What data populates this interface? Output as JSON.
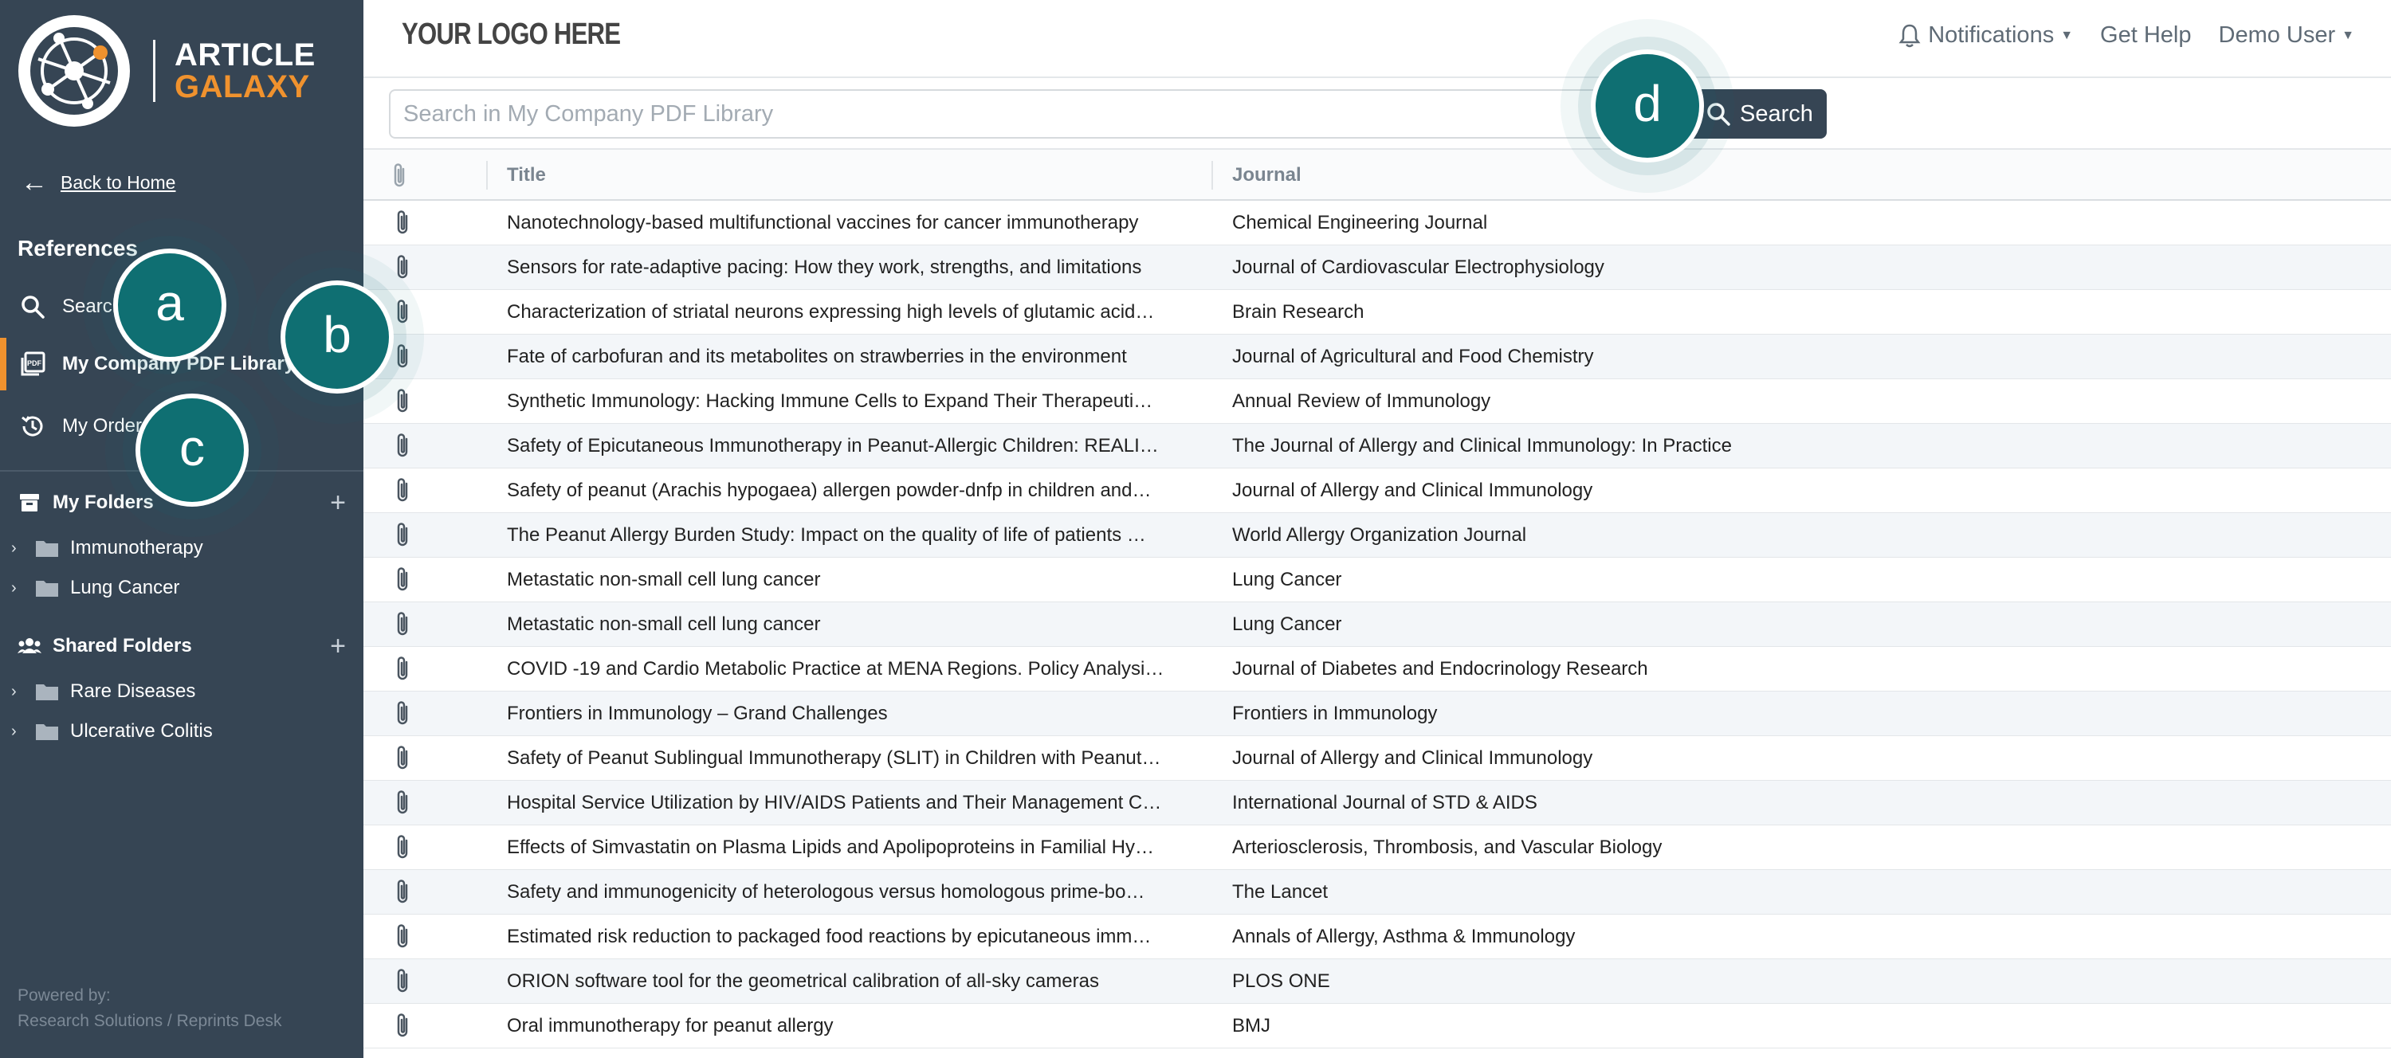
{
  "brand": {
    "line1": "ARTICLE",
    "line2": "GALAXY",
    "accent_color": "#f0922e",
    "sidebar_color": "#364554"
  },
  "sidebar": {
    "back_label": "Back to Home",
    "references_heading": "References",
    "nav": [
      {
        "label": "Search",
        "icon": "search-icon"
      },
      {
        "label": "My Company PDF Library",
        "icon": "pdf-library-icon",
        "active": true
      },
      {
        "label": "My Orders",
        "icon": "history-icon"
      }
    ],
    "my_folders": {
      "heading": "My Folders",
      "items": [
        "Immunotherapy",
        "Lung Cancer"
      ]
    },
    "shared_folders": {
      "heading": "Shared Folders",
      "items": [
        "Rare Diseases",
        "Ulcerative Colitis"
      ]
    },
    "powered_by": "Powered by:",
    "powered_company": "Research Solutions / Reprints Desk"
  },
  "header": {
    "logo_placeholder": "YOUR LOGO HERE",
    "notifications": "Notifications",
    "help": "Get Help",
    "user": "Demo User"
  },
  "search": {
    "placeholder": "Search in My Company PDF Library",
    "button": "Search"
  },
  "table": {
    "columns": {
      "title": "Title",
      "journal": "Journal"
    },
    "rows": [
      {
        "title": "Nanotechnology-based multifunctional vaccines for cancer immunotherapy",
        "journal": "Chemical Engineering Journal"
      },
      {
        "title": "Sensors for rate-adaptive pacing: How they work, strengths, and limitations",
        "journal": "Journal of Cardiovascular Electrophysiology"
      },
      {
        "title": "Characterization of striatal neurons expressing high levels of glutamic acid…",
        "journal": "Brain Research"
      },
      {
        "title": "Fate of carbofuran and its metabolites on strawberries in the environment",
        "journal": "Journal of Agricultural and Food Chemistry"
      },
      {
        "title": "Synthetic Immunology: Hacking Immune Cells to Expand Their Therapeuti…",
        "journal": "Annual Review of Immunology"
      },
      {
        "title": "Safety of Epicutaneous Immunotherapy in Peanut-Allergic Children: REALI…",
        "journal": "The Journal of Allergy and Clinical Immunology: In Practice"
      },
      {
        "title": "Safety of peanut (Arachis hypogaea) allergen powder-dnfp in children and…",
        "journal": "Journal of Allergy and Clinical Immunology"
      },
      {
        "title": "The Peanut Allergy Burden Study: Impact on the quality of life of patients …",
        "journal": "World Allergy Organization Journal"
      },
      {
        "title": "Metastatic non-small cell lung cancer",
        "journal": "Lung Cancer"
      },
      {
        "title": "Metastatic non-small cell lung cancer",
        "journal": "Lung Cancer"
      },
      {
        "title": "COVID -19 and Cardio Metabolic Practice at MENA Regions. Policy Analysi…",
        "journal": "Journal of Diabetes and Endocrinology Research"
      },
      {
        "title": "Frontiers in Immunology – Grand Challenges",
        "journal": "Frontiers in Immunology"
      },
      {
        "title": "Safety of Peanut Sublingual Immunotherapy (SLIT) in Children with Peanut…",
        "journal": "Journal of Allergy and Clinical Immunology"
      },
      {
        "title": "Hospital Service Utilization by HIV/AIDS Patients and Their Management C…",
        "journal": "International Journal of STD & AIDS"
      },
      {
        "title": "Effects of Simvastatin on Plasma Lipids and Apolipoproteins in Familial Hy…",
        "journal": "Arteriosclerosis, Thrombosis, and Vascular Biology"
      },
      {
        "title": "Safety and immunogenicity of heterologous versus homologous prime-bo…",
        "journal": "The Lancet"
      },
      {
        "title": "Estimated risk reduction to packaged food reactions by epicutaneous imm…",
        "journal": "Annals of Allergy, Asthma & Immunology"
      },
      {
        "title": "ORION software tool for the geometrical calibration of all-sky cameras",
        "journal": "PLOS ONE"
      },
      {
        "title": "Oral immunotherapy for peanut allergy",
        "journal": "BMJ"
      }
    ]
  },
  "callouts": {
    "a": "a",
    "b": "b",
    "c": "c",
    "d": "d",
    "color": "#0f6f72"
  }
}
